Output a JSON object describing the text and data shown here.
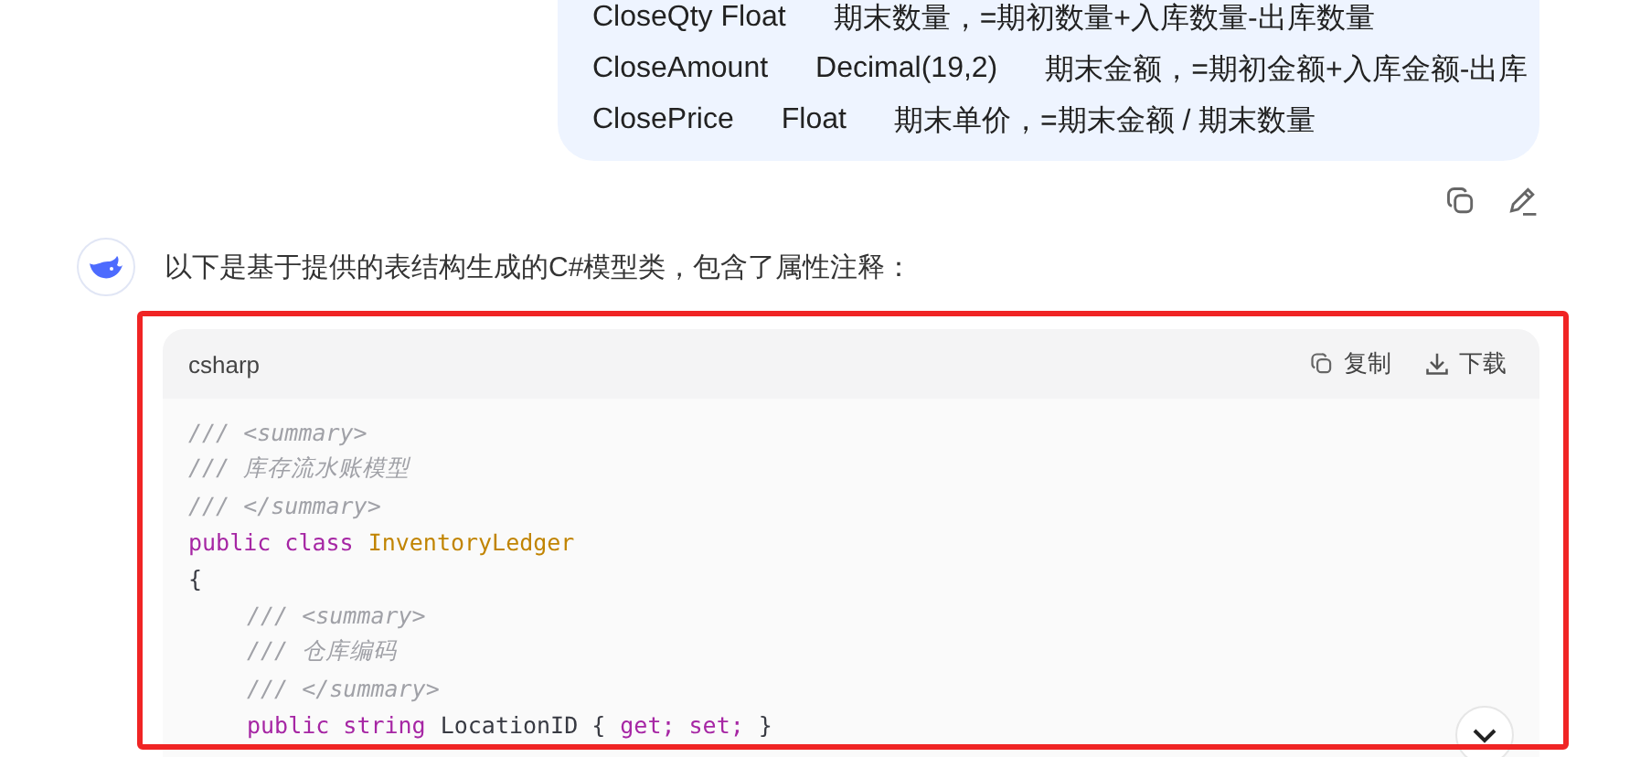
{
  "user_message": {
    "rows": [
      {
        "cells": [
          "CloseQty Float",
          "期末数量，=期初数量+入库数量-出库数量"
        ]
      },
      {
        "cells": [
          "CloseAmount",
          "Decimal(19,2)",
          "期末金额，=期初金额+入库金额-出库"
        ]
      },
      {
        "cells": [
          "ClosePrice",
          "Float",
          "期末单价，=期末金额 / 期末数量"
        ]
      }
    ]
  },
  "reply": {
    "intro": "以下是基于提供的表结构生成的C#模型类，包含了属性注释：",
    "code_block": {
      "language": "csharp",
      "actions": [
        {
          "kind": "copy",
          "label": "复制"
        },
        {
          "kind": "download",
          "label": "下载"
        }
      ],
      "lines": [
        {
          "tokens": [
            {
              "kind": "comment",
              "text": "/// <summary>"
            }
          ]
        },
        {
          "tokens": [
            {
              "kind": "comment",
              "text": "/// 库存流水账模型"
            }
          ]
        },
        {
          "tokens": [
            {
              "kind": "comment",
              "text": "/// </summary>"
            }
          ]
        },
        {
          "tokens": [
            {
              "kind": "keyword",
              "text": "public class"
            },
            {
              "kind": "type",
              "text": "InventoryLedger"
            }
          ]
        },
        {
          "tokens": [
            {
              "kind": "plain",
              "text": "{"
            }
          ],
          "children": [
            {
              "tokens": [
                {
                  "kind": "comment",
                  "text": "/// <summary>"
                }
              ]
            },
            {
              "tokens": [
                {
                  "kind": "comment",
                  "text": "/// 仓库编码"
                }
              ]
            },
            {
              "tokens": [
                {
                  "kind": "comment",
                  "text": "/// </summary>"
                }
              ]
            },
            {
              "tokens": [
                {
                  "kind": "keyword",
                  "text": "public string"
                },
                {
                  "kind": "plain",
                  "text": "LocationID {"
                },
                {
                  "kind": "keyword",
                  "text": "get; set;"
                },
                {
                  "kind": "plain",
                  "text": "}"
                }
              ]
            }
          ]
        }
      ]
    }
  }
}
